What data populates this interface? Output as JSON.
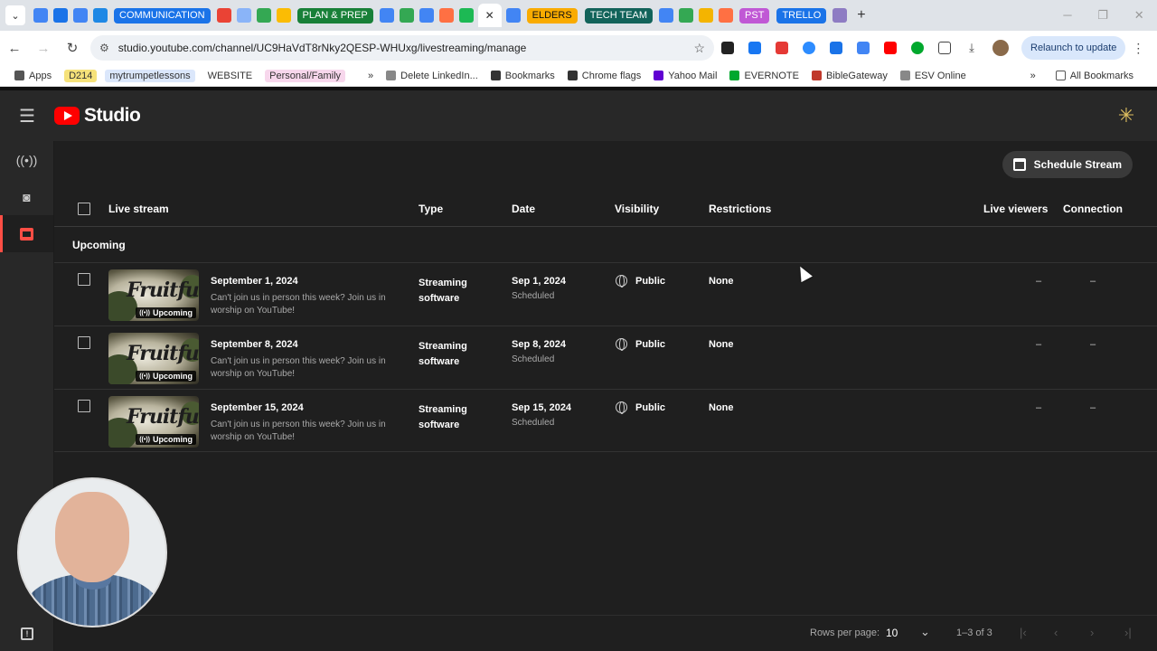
{
  "browser": {
    "tab_groups": [
      {
        "label": "COMMUNICATION",
        "color": "#1a73e8"
      },
      {
        "label": "PLAN & PREP",
        "color": "#188038"
      },
      {
        "label": "ELDERS",
        "color": "#f9ab00"
      },
      {
        "label": "TECH TEAM",
        "color": "#12635a"
      },
      {
        "label": "PST",
        "color": "#c058d5"
      },
      {
        "label": "TRELLO",
        "color": "#1a73e8"
      }
    ],
    "active_tab_close": "✕",
    "new_tab": "+",
    "url": "studio.youtube.com/channel/UC9HaVdT8rNky2QESP-WHUxg/livestreaming/manage",
    "relaunch_label": "Relaunch to update",
    "bookmarks": [
      {
        "label": "Apps",
        "color": "#555555"
      },
      {
        "label": "D214",
        "color": "#f6e27a",
        "chip": true
      },
      {
        "label": "mytrumpetlessons",
        "color": "#dbe7fb",
        "chip": true
      },
      {
        "label": "WEBSITE",
        "color": "#ffffff",
        "chip": true
      },
      {
        "label": "Personal/Family",
        "color": "#f7d7ec",
        "chip": true
      },
      {
        "label": "»",
        "color": "#ffffff"
      },
      {
        "label": "Delete LinkedIn...",
        "color": "#888888"
      },
      {
        "label": "Bookmarks",
        "color": "#333333"
      },
      {
        "label": "Chrome flags",
        "color": "#333333"
      },
      {
        "label": "Yahoo Mail",
        "color": "#6001d2"
      },
      {
        "label": "EVERNOTE",
        "color": "#00a82d"
      },
      {
        "label": "BibleGateway",
        "color": "#c0392b"
      },
      {
        "label": "ESV Online",
        "color": "#888888"
      }
    ],
    "bookmarks_overflow": "»",
    "all_bookmarks": "All Bookmarks"
  },
  "studio": {
    "logo_text": "Studio",
    "schedule_button": "Schedule Stream",
    "columns": {
      "live_stream": "Live stream",
      "type": "Type",
      "date": "Date",
      "visibility": "Visibility",
      "restrictions": "Restrictions",
      "live_viewers": "Live viewers",
      "connection": "Connection"
    },
    "section": "Upcoming",
    "thumb_word": "Fruitful",
    "rows": [
      {
        "title": "September 1, 2024",
        "description": "Can't join us in person this week? Join us in worship on YouTube!",
        "badge": "Upcoming",
        "type": "Streaming software",
        "date": "Sep 1, 2024",
        "date_status": "Scheduled",
        "visibility": "Public",
        "restrictions": "None",
        "live_viewers": "–",
        "connection": "–"
      },
      {
        "title": "September 8, 2024",
        "description": "Can't join us in person this week? Join us in worship on YouTube!",
        "badge": "Upcoming",
        "type": "Streaming software",
        "date": "Sep 8, 2024",
        "date_status": "Scheduled",
        "visibility": "Public",
        "restrictions": "None",
        "live_viewers": "–",
        "connection": "–"
      },
      {
        "title": "September 15, 2024",
        "description": "Can't join us in person this week? Join us in worship on YouTube!",
        "badge": "Upcoming",
        "type": "Streaming software",
        "date": "Sep 15, 2024",
        "date_status": "Scheduled",
        "visibility": "Public",
        "restrictions": "None",
        "live_viewers": "–",
        "connection": "–"
      }
    ],
    "pagination": {
      "rows_per_page_label": "Rows per page:",
      "rows_per_page": "10",
      "range": "1–3 of 3"
    }
  }
}
